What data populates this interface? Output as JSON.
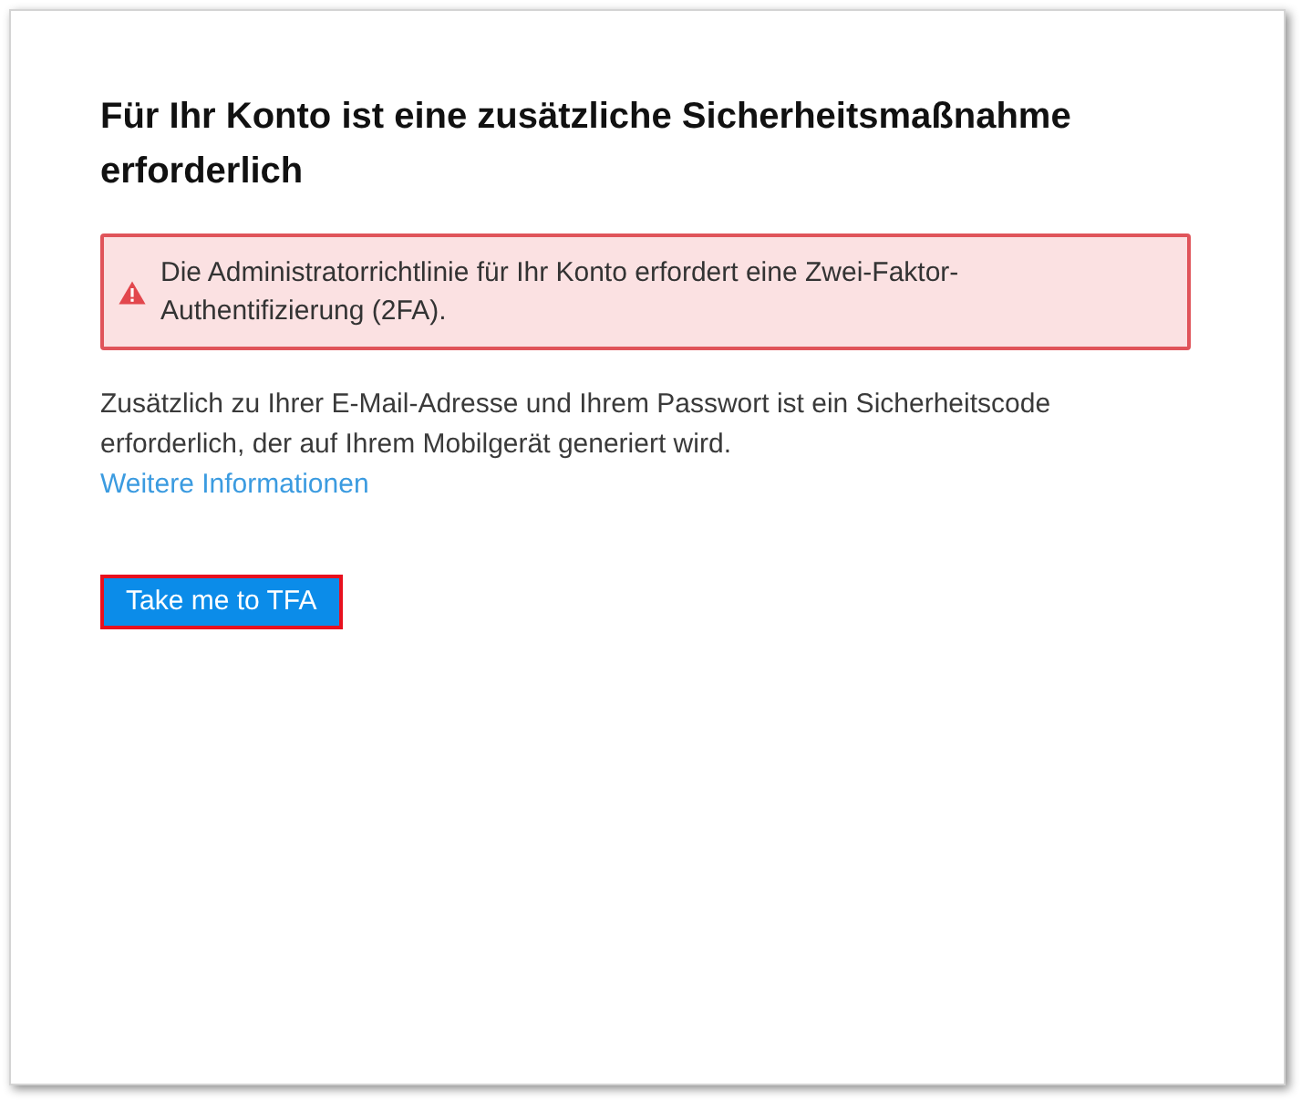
{
  "heading": "Für Ihr Konto ist eine zusätzliche Sicherheitsmaßnahme erforderlich",
  "alert": {
    "kind": "error",
    "text": "Die Administratorrichtlinie für Ihr Konto erfordert eine Zwei-Faktor-Authentifizierung (2FA)."
  },
  "description": "Zusätzlich zu Ihrer E-Mail-Adresse und Ihrem Passwort ist ein Sicherheitscode erforderlich, der auf Ihrem Mobilgerät generiert wird.",
  "link": "Weitere Informationen",
  "button": {
    "label": "Take me to TFA",
    "focused": true
  }
}
